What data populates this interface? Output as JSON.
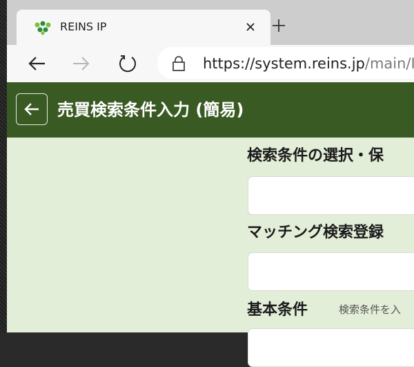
{
  "browser": {
    "tab_title": "REINS IP",
    "url_host": "https://system.reins.jp",
    "url_path": "/main/I"
  },
  "header": {
    "title": "売買検索条件入力 (簡易)"
  },
  "sections": {
    "condition_select_label": "検索条件の選択・保",
    "matching_label": "マッチング検索登録",
    "basic_label": "基本条件",
    "basic_hint": "検索条件を入"
  },
  "colors": {
    "header_green": "#3a5a23",
    "page_bg": "#e3eed9"
  }
}
